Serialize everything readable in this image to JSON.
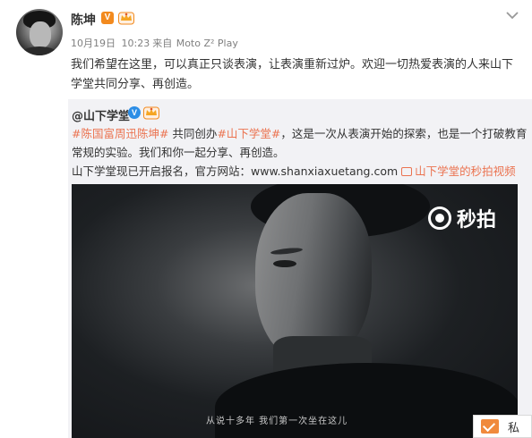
{
  "post": {
    "author": "陈坤",
    "verified_badge": "V",
    "meta": {
      "date": "10月19日",
      "time": "10:23",
      "source_prefix": "来自",
      "source": "Moto Z² Play"
    },
    "content": "我们希望在这里，可以真正只谈表演，让表演重新过炉。欢迎一切热爱表演的人来山下学堂共同分享、再创造。"
  },
  "repost": {
    "user": "@山下学堂",
    "verified_badge": "V",
    "tag1": "#陈国富周迅陈坤#",
    "text1": " 共同创办",
    "tag2": "#山下学堂#",
    "text2": "，这是一次从表演开始的探索，也是一个打破教育常规的实验。我们和你一起分享、再创造。",
    "line3_prefix": "山下学堂现已开启报名，官方网站：",
    "website": "www.shanxiaxuetang.com",
    "video_link": "山下学堂的秒拍视频"
  },
  "video": {
    "watermark": "秒拍",
    "subtitle": "从说十多年  我们第一次坐在这儿"
  },
  "chat": {
    "label": "私"
  },
  "colors": {
    "link": "#eb7350",
    "repost_bg": "#f2f2f5",
    "vip_badge": "#f28a1e",
    "verified_blue": "#2d8ee6"
  },
  "icons": {
    "dropdown": "chevron-down-icon",
    "vip": "vip-crown-icon",
    "video": "video-icon",
    "message": "envelope-icon"
  }
}
